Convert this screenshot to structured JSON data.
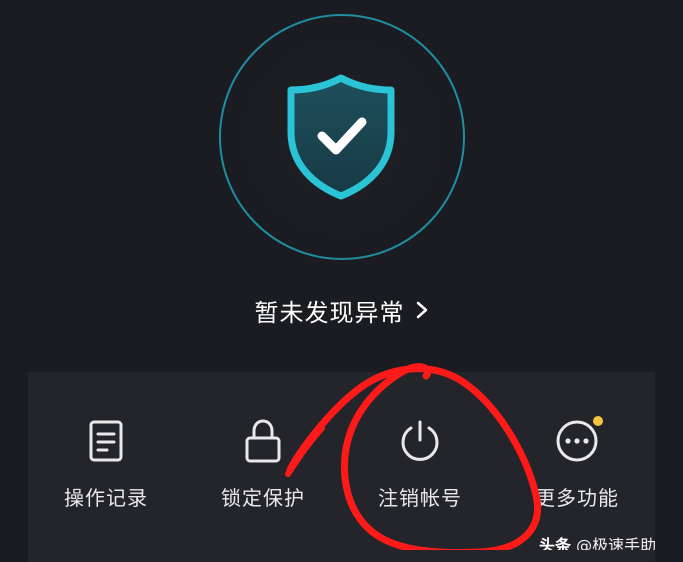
{
  "security": {
    "status_text": "暂未发现异常",
    "shield_icon": "shield-check-icon",
    "colors": {
      "background": "#1b1c21",
      "panel": "#23252b",
      "accent": "#2bc3d6",
      "badge": "#f6c342",
      "annotation": "#ff1a1a"
    }
  },
  "actions": [
    {
      "label": "操作记录",
      "icon": "document-icon"
    },
    {
      "label": "锁定保护",
      "icon": "lock-icon"
    },
    {
      "label": "注销帐号",
      "icon": "power-icon"
    },
    {
      "label": "更多功能",
      "icon": "more-dots-icon",
      "has_badge": true
    }
  ],
  "watermark": {
    "brand": "头条",
    "handle": "@极速手助"
  }
}
